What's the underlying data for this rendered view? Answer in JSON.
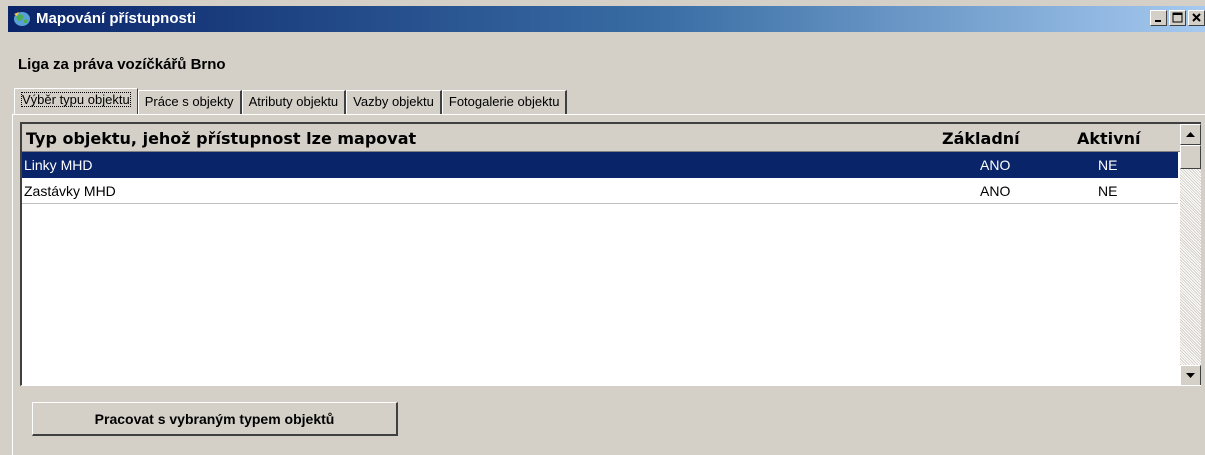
{
  "window": {
    "title": "Mapování přístupnosti"
  },
  "org_name": "Liga za práva vozíčkářů Brno",
  "tabs": [
    {
      "label": "Výběr typu objektu",
      "active": true
    },
    {
      "label": "Práce s objekty",
      "active": false
    },
    {
      "label": "Atributy objektu",
      "active": false
    },
    {
      "label": "Vazby objektu",
      "active": false
    },
    {
      "label": "Fotogalerie objektu",
      "active": false
    }
  ],
  "grid": {
    "columns": {
      "type": "Typ objektu, jehož přístupnost lze mapovat",
      "basic": "Základní",
      "active": "Aktivní"
    },
    "rows": [
      {
        "name": "Linky MHD",
        "basic": "ANO",
        "active": "NE",
        "selected": true
      },
      {
        "name": "Zastávky MHD",
        "basic": "ANO",
        "active": "NE",
        "selected": false
      }
    ]
  },
  "action_button": {
    "label": "Pracovat s vybraným typem objektů"
  },
  "icons": {
    "app": "map-globe-icon",
    "minimize": "minimize-icon",
    "maximize": "maximize-icon",
    "close": "close-icon",
    "scroll_up": "arrow-up-icon",
    "scroll_down": "arrow-down-icon"
  },
  "colors": {
    "selection": "#0a246a",
    "face": "#d4d0c8"
  }
}
